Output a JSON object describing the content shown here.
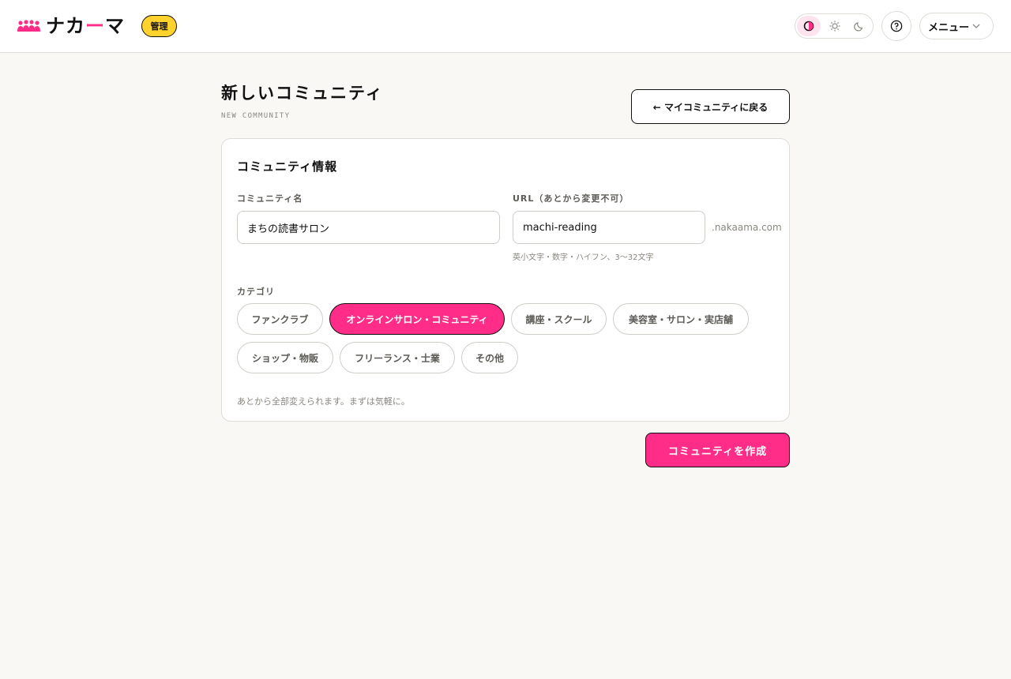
{
  "header": {
    "brand": "ナカーマ",
    "admin_badge": "管理",
    "theme_options": [
      "contrast-icon",
      "sun-icon",
      "moon-icon"
    ],
    "menu_label": "メニュー",
    "accent_color": "#ff2d87",
    "badge_color": "#ffd22e"
  },
  "page": {
    "title": "新しいコミュニティ",
    "subtitle": "NEW COMMUNITY",
    "back_label": "← マイコミュニティに戻る"
  },
  "form": {
    "section_title": "コミュニティ情報",
    "name_label": "コミュニティ名",
    "name_value": "まちの読書サロン",
    "url_label": "URL（あとから変更不可）",
    "url_value": "machi-reading",
    "url_suffix": ".nakaama.com",
    "url_hint": "英小文字・数字・ハイフン、3〜32文字",
    "category_label": "カテゴリ",
    "categories": [
      {
        "label": "ファンクラブ",
        "selected": false
      },
      {
        "label": "オンラインサロン・コミュニティ",
        "selected": true
      },
      {
        "label": "講座・スクール",
        "selected": false
      },
      {
        "label": "美容室・サロン・実店舗",
        "selected": false
      },
      {
        "label": "ショップ・物販",
        "selected": false
      },
      {
        "label": "フリーランス・士業",
        "selected": false
      },
      {
        "label": "その他",
        "selected": false
      }
    ],
    "footer_note": "あとから全部変えられます。まずは気軽に。",
    "submit_label": "コミュニティを作成"
  }
}
